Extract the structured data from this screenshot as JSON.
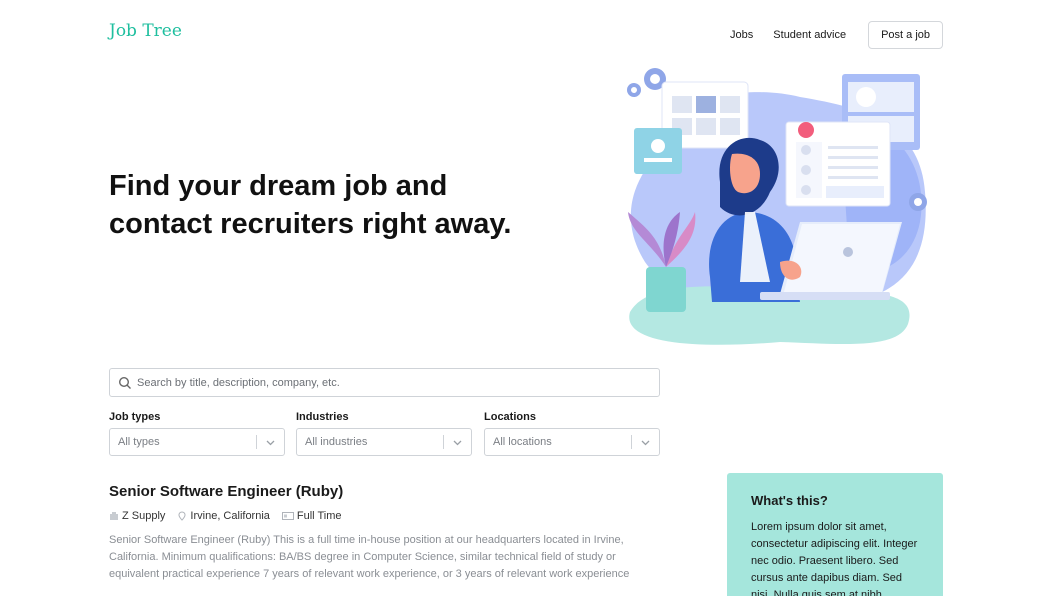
{
  "brand": {
    "logo": "Job Tree"
  },
  "nav": {
    "jobs": "Jobs",
    "student_advice": "Student advice",
    "post_job": "Post a job"
  },
  "hero": {
    "line1": "Find your dream job and",
    "line2": "contact recruiters right away."
  },
  "search": {
    "placeholder": "Search by title, description, company, etc."
  },
  "filters": [
    {
      "label": "Job types",
      "value": "All types"
    },
    {
      "label": "Industries",
      "value": "All industries"
    },
    {
      "label": "Locations",
      "value": "All locations"
    }
  ],
  "job": {
    "title": "Senior Software Engineer (Ruby)",
    "company": "Z Supply",
    "location": "Irvine, California",
    "type": "Full Time",
    "description": "Senior Software Engineer (Ruby) This is a full time in-house position at our headquarters located in Irvine, California. Minimum qualifications: BA/BS degree in Computer Science, similar technical field of study or equivalent practical experience 7 years of relevant work experience, or 3 years of relevant work experience"
  },
  "info_card": {
    "title": "What's this?",
    "body": "Lorem ipsum dolor sit amet, consectetur adipiscing elit. Integer nec odio. Praesent libero. Sed cursus ante dapibus diam. Sed nisi. Nulla quis sem at nibh"
  },
  "colors": {
    "brand": "#1fbf9f",
    "card_bg": "#a5e6dc",
    "illustration_blue": "#6f8ff5"
  }
}
